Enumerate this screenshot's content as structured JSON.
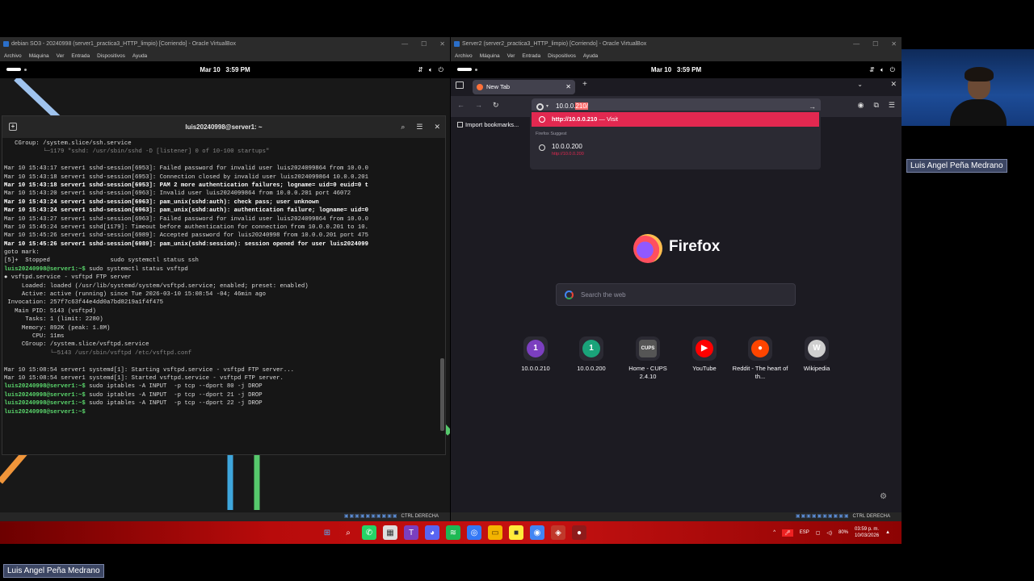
{
  "left_vm": {
    "title": "debian SO3 - 20240998 (server1_practica3_HTTP_limpio) [Corriendo] - Oracle VirtualBox",
    "menu": [
      "Archivo",
      "Máquina",
      "Ver",
      "Entrada",
      "Dispositivos",
      "Ayuda"
    ],
    "date": "Mar 10",
    "time": "3:59 PM",
    "status_host_key": "CTRL DERECHA",
    "terminal": {
      "title": "luis20240998@server1: ~",
      "lines": [
        "   CGroup: /system.slice/ssh.service",
        "           └─1179 \"sshd: /usr/sbin/sshd -D [listener] 0 of 10-100 startups\"",
        "",
        "Mar 10 15:43:17 server1 sshd-session[6953]: Failed password for invalid user luis2024099864 from 10.0.0",
        "Mar 10 15:43:18 server1 sshd-session[6953]: Connection closed by invalid user luis2024099864 10.0.0.201",
        "Mar 10 15:43:18 server1 sshd-session[6953]: PAM 2 more authentication failures; logname= uid=0 euid=0 t",
        "Mar 10 15:43:20 server1 sshd-session[6963]: Invalid user luis2024099864 from 10.0.0.201 port 46072",
        "Mar 10 15:43:24 server1 sshd-session[6963]: pam_unix(sshd:auth): check pass; user unknown",
        "Mar 10 15:43:24 server1 sshd-session[6963]: pam_unix(sshd:auth): authentication failure; logname= uid=0",
        "Mar 10 15:43:27 server1 sshd-session[6963]: Failed password for invalid user luis2024099864 from 10.0.0",
        "Mar 10 15:45:24 server1 sshd[1179]: Timeout before authentication for connection from 10.0.0.201 to 10.",
        "Mar 10 15:45:26 server1 sshd-session[6989]: Accepted password for luis20240998 from 10.0.0.201 port 475",
        "Mar 10 15:45:26 server1 sshd-session[6989]: pam_unix(sshd:session): session opened for user luis2024099",
        "goto mark:",
        "[5]+  Stopped                 sudo systemctl status ssh",
        "luis20240998@server1:~$ sudo systemctl status vsftpd",
        "● vsftpd.service - vsftpd FTP server",
        "     Loaded: loaded (/usr/lib/systemd/system/vsftpd.service; enabled; preset: enabled)",
        "     Active: active (running) since Tue 2026-03-10 15:08:54 -04; 46min ago",
        " Invocation: 257f7c63f44e4dd0a7bd8219a1f4f475",
        "   Main PID: 5143 (vsftpd)",
        "      Tasks: 1 (limit: 2280)",
        "     Memory: 892K (peak: 1.8M)",
        "        CPU: 11ms",
        "     CGroup: /system.slice/vsftpd.service",
        "             └─5143 /usr/sbin/vsftpd /etc/vsftpd.conf",
        "",
        "Mar 10 15:08:54 server1 systemd[1]: Starting vsftpd.service - vsftpd FTP server...",
        "Mar 10 15:08:54 server1 systemd[1]: Started vsftpd.service - vsftpd FTP server.",
        "luis20240998@server1:~$ sudo iptables -A INPUT  -p tcp --dport 80 -j DROP",
        "luis20240998@server1:~$ sudo iptables -A INPUT  -p tcp --dport 21 -j DROP",
        "luis20240998@server1:~$ sudo iptables -A INPUT  -p tcp --dport 22 -j DROP",
        "luis20240998@server1:~$ "
      ]
    }
  },
  "right_vm": {
    "title": "Server2 (server2_practica3_HTTP_limpio) [Corriendo] - Oracle VirtualBox",
    "menu": [
      "Archivo",
      "Máquina",
      "Ver",
      "Entrada",
      "Dispositivos",
      "Ayuda"
    ],
    "date": "Mar 10",
    "time": "3:59 PM",
    "status_host_key": "CTRL DERECHA",
    "firefox": {
      "tab_title": "New Tab",
      "url_typed": "10.0.0.",
      "url_autofill": "210/",
      "suggestion_visit_url": "http://10.0.0.210",
      "suggestion_visit_label": "— Visit",
      "suggest_header": "Firefox Suggest",
      "suggest_item": "10.0.0.200",
      "suggest_item_sub": "http://10.0.0.200",
      "import_bookmarks": "Import bookmarks...",
      "brand": "Firefox",
      "search_placeholder": "Search the web",
      "shortcuts": [
        {
          "label": "10.0.0.210",
          "glyph": "1",
          "color": "#7b3fbf"
        },
        {
          "label": "10.0.0.200",
          "glyph": "1",
          "color": "#1aa37a"
        },
        {
          "label": "Home - CUPS 2.4.10",
          "glyph": "CUPS",
          "color": "#555"
        },
        {
          "label": "YouTube",
          "glyph": "▶",
          "color": "#ff0000"
        },
        {
          "label": "Reddit - The heart of th...",
          "glyph": "●",
          "color": "#ff4500"
        },
        {
          "label": "Wikipedia",
          "glyph": "W",
          "color": "#cfcfcf"
        }
      ]
    }
  },
  "taskbar": {
    "lang": "ESP",
    "battery": "80%",
    "clock_time": "03:59 p. m.",
    "clock_date": "10/03/2026"
  },
  "presenter_name": "Luis Angel Peña Medrano",
  "colors": {
    "firefox_accent": "#e22850",
    "terminal_green": "#5bd86d",
    "taskbar_red": "#c51111"
  }
}
